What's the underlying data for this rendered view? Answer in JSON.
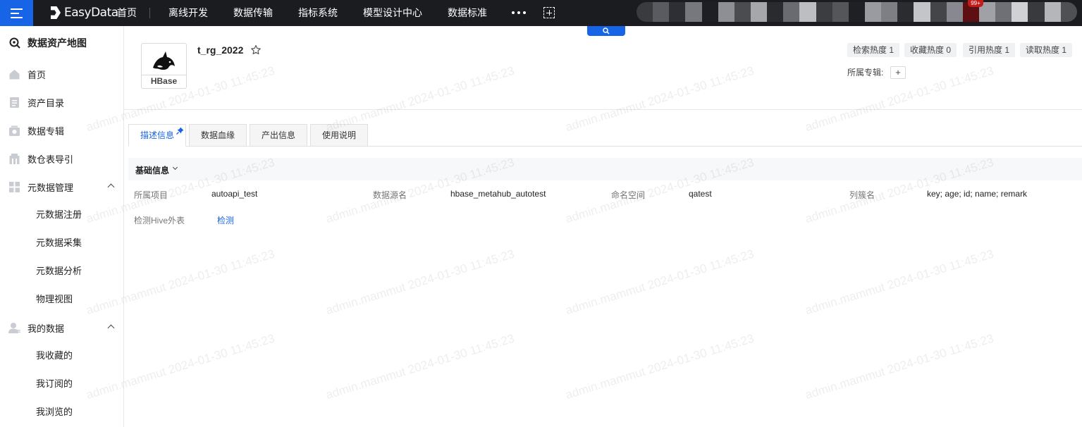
{
  "topnav": {
    "logo": "EasyData",
    "items": [
      "首页",
      "离线开发",
      "数据传输",
      "指标系统",
      "模型设计中心",
      "数据标准"
    ],
    "badge": "99+"
  },
  "sidebar": {
    "title": "数据资产地图",
    "items": [
      {
        "label": "首页",
        "icon": "home-icon"
      },
      {
        "label": "资产目录",
        "icon": "catalog-icon"
      },
      {
        "label": "数据专辑",
        "icon": "album-icon"
      },
      {
        "label": "数仓表导引",
        "icon": "warehouse-icon"
      },
      {
        "label": "元数据管理",
        "icon": "grid-icon"
      }
    ],
    "metadata_sub": [
      "元数据注册",
      "元数据采集",
      "元数据分析",
      "物理视图"
    ],
    "my_data": {
      "label": "我的数据",
      "icon": "user-icon"
    },
    "my_data_sub": [
      "我收藏的",
      "我订阅的",
      "我浏览的"
    ]
  },
  "header": {
    "logo_label": "HBase",
    "table_name": "t_rg_2022",
    "heat": [
      "检索热度 1",
      "收藏热度 0",
      "引用热度 1",
      "读取热度 1"
    ],
    "topic_label": "所属专辑:",
    "topic_add": "+"
  },
  "tabs": [
    "描述信息",
    "数据血缘",
    "产出信息",
    "使用说明"
  ],
  "basic": {
    "title": "基础信息",
    "fields": [
      {
        "label": "所属项目",
        "value": "autoapi_test"
      },
      {
        "label": "数据源名",
        "value": "hbase_metahub_autotest"
      },
      {
        "label": "命名空间",
        "value": "qatest"
      },
      {
        "label": "列簇名",
        "value": "key; age; id; name; remark"
      }
    ],
    "hive_label": "检测Hive外表",
    "hive_action": "检测"
  },
  "watermark": "admin.mammut 2024-01-30 11:45:23",
  "colors": {
    "accent": "#1764e6",
    "topbar": "#1b1c1f"
  }
}
